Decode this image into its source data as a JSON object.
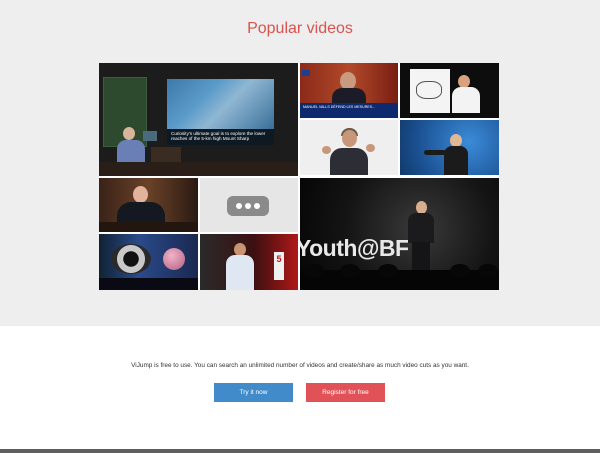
{
  "hero": {
    "title": "Popular videos",
    "title_color": "#d9534f",
    "background": "#eeeeee"
  },
  "videos": [
    {
      "label": "lecture-slide-speaker",
      "caption": "Curiosity's ultimate goal is to explore the lower reaches of the 5-km high Mount Sharp"
    },
    {
      "label": "news-interview",
      "ticker": "MANUEL VALLS DÉFEND LES MESURES..."
    },
    {
      "label": "whiteboard-presenter"
    },
    {
      "label": "speaker-gesturing"
    },
    {
      "label": "speaker-blue-stage"
    },
    {
      "label": "formal-speaker-podium"
    },
    {
      "label": "loading-placeholder"
    },
    {
      "label": "stage-talk-youth",
      "stage_text": "Youth@BF"
    },
    {
      "label": "eye-and-planet-stage"
    },
    {
      "label": "speaker-red-stage",
      "sign_text": "5"
    }
  ],
  "cta": {
    "text": "ViJump is free to use. You can search an unlimited number of videos and create/share as much video cuts as you want.",
    "try_label": "Try it now",
    "register_label": "Register for free",
    "try_color": "#428bca",
    "register_color": "#e15258"
  },
  "icons": {
    "loading": "more-dots-icon"
  }
}
